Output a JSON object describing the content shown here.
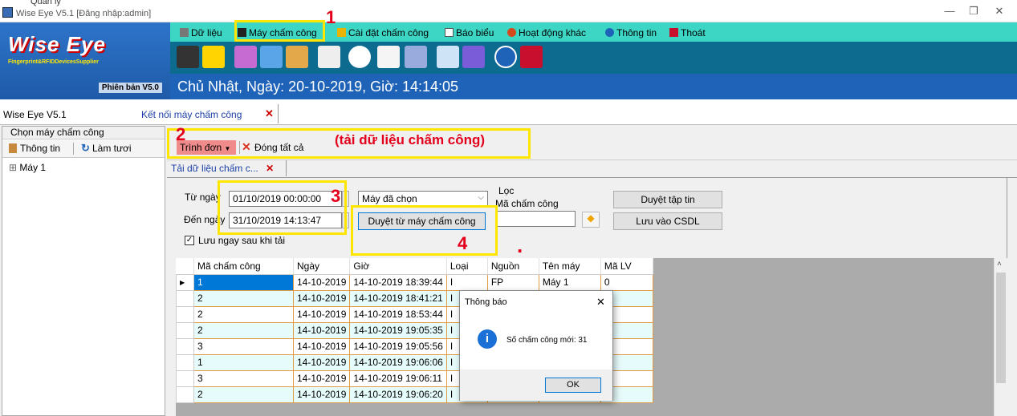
{
  "titlebar": {
    "cut_text": "Quản lý",
    "title": "Wise Eye V5.1 [Đăng nhập:admin]",
    "minimize": "—",
    "restore": "❐",
    "close": "✕"
  },
  "logo": {
    "brand": "Wise Eye",
    "subtitle": "Fingerprint&RFIDDevicesSupplier",
    "version": "Phiên bản V5.0"
  },
  "menu": {
    "items": [
      {
        "label": "Dữ liệu",
        "icon": "database-icon"
      },
      {
        "label": "Máy chấm công",
        "icon": "device-icon"
      },
      {
        "label": "Cài đặt chấm công",
        "icon": "settings-icon"
      },
      {
        "label": "Báo biểu",
        "icon": "report-icon"
      },
      {
        "label": "Hoạt động khác",
        "icon": "activity-icon"
      },
      {
        "label": "Thông tin",
        "icon": "info-icon"
      },
      {
        "label": "Thoát",
        "icon": "exit-icon"
      }
    ]
  },
  "datebar": {
    "text": "Chủ Nhật, Ngày: 20-10-2019, Giờ: 14:14:05"
  },
  "tabs": {
    "home": "Wise Eye V5.1",
    "active": "Kết nối máy chấm công",
    "close": "✕"
  },
  "left": {
    "header": "Chọn máy chấm công",
    "info_button": "Thông tin",
    "refresh_button": "Làm tươi",
    "tree_expand": "⊞",
    "tree_item": "Máy 1"
  },
  "maintools": {
    "menu_button": "Trình đơn",
    "close_all": "Đóng tất cả",
    "inner_tab": "Tải dữ liệu chấm c...",
    "inner_tab_close": "✕"
  },
  "form": {
    "from_label": "Từ ngày",
    "from_value": "01/10/2019 00:00:00",
    "to_label": "Đến ngày",
    "to_value": "31/10/2019 14:13:47",
    "machine_select": "Máy đã chọn",
    "browse_machine": "Duyệt từ máy chấm công",
    "filter_title": "Lọc",
    "filter_label": "Mã chấm công",
    "filter_value": "",
    "browse_file": "Duyệt tập tin",
    "save_db": "Lưu vào CSDL",
    "save_checkbox": "Lưu ngay sau khi tải",
    "save_checked": true
  },
  "grid": {
    "columns": [
      "Mã chấm công",
      "Ngày",
      "Giờ",
      "Loại",
      "Nguồn",
      "Tên máy",
      "Mã LV"
    ],
    "rows": [
      [
        "1",
        "14-10-2019",
        "14-10-2019 18:39:44",
        "I",
        "FP",
        "Máy 1",
        "0"
      ],
      [
        "2",
        "14-10-2019",
        "14-10-2019 18:41:21",
        "I",
        "",
        "",
        ""
      ],
      [
        "2",
        "14-10-2019",
        "14-10-2019 18:53:44",
        "I",
        "",
        "",
        ""
      ],
      [
        "2",
        "14-10-2019",
        "14-10-2019 19:05:35",
        "I",
        "",
        "",
        ""
      ],
      [
        "3",
        "14-10-2019",
        "14-10-2019 19:05:56",
        "I",
        "",
        "",
        ""
      ],
      [
        "1",
        "14-10-2019",
        "14-10-2019 19:06:06",
        "I",
        "",
        "",
        ""
      ],
      [
        "3",
        "14-10-2019",
        "14-10-2019 19:06:11",
        "I",
        "",
        "",
        ""
      ],
      [
        "2",
        "14-10-2019",
        "14-10-2019 19:06:20",
        "I",
        "",
        "",
        ""
      ]
    ]
  },
  "dialog": {
    "title": "Thông báo",
    "message": "Số chấm công mới: 31",
    "ok": "OK",
    "close": "✕"
  },
  "annotations": {
    "n1": "1",
    "n2": "2",
    "n3": "3",
    "n4": "4",
    "dot": ".",
    "note": "(tải dữ liệu chấm công)"
  },
  "colors": {
    "menubar": "#3dd6c5",
    "iconbar": "#0d6b8f",
    "datebar": "#1f63b8",
    "annotation": "#ffe600",
    "annotation_text": "#e3001b"
  }
}
